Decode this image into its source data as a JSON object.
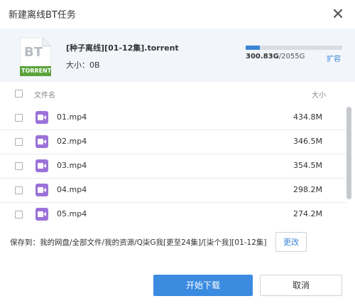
{
  "dialog": {
    "title": "新建离线BT任务",
    "close_icon": "close-icon"
  },
  "file": {
    "icon_top": "BT",
    "icon_label": "TORRENT",
    "name": "[种子离线][01-12集].torrent",
    "size_label": "大小：",
    "size_value": "0B"
  },
  "storage": {
    "used": "300.83G",
    "total": "/2055G",
    "used_fraction": 0.146,
    "expand_label": "扩容",
    "accent": "#3a86d6"
  },
  "list": {
    "col_name": "文件名",
    "col_size": "大小",
    "rows": [
      {
        "name": "01.mp4",
        "size": "434.8M"
      },
      {
        "name": "02.mp4",
        "size": "346.5M"
      },
      {
        "name": "03.mp4",
        "size": "354.5M"
      },
      {
        "name": "04.mp4",
        "size": "298.2M"
      },
      {
        "name": "05.mp4",
        "size": "274.2M"
      }
    ]
  },
  "save": {
    "label": "保存到：",
    "path": "我的网盘/全部文件/我的资源/Q柒G我[更至24集]/[柒个我][01-12集]",
    "change_label": "更改"
  },
  "footer": {
    "start_label": "开始下载",
    "cancel_label": "取消"
  }
}
